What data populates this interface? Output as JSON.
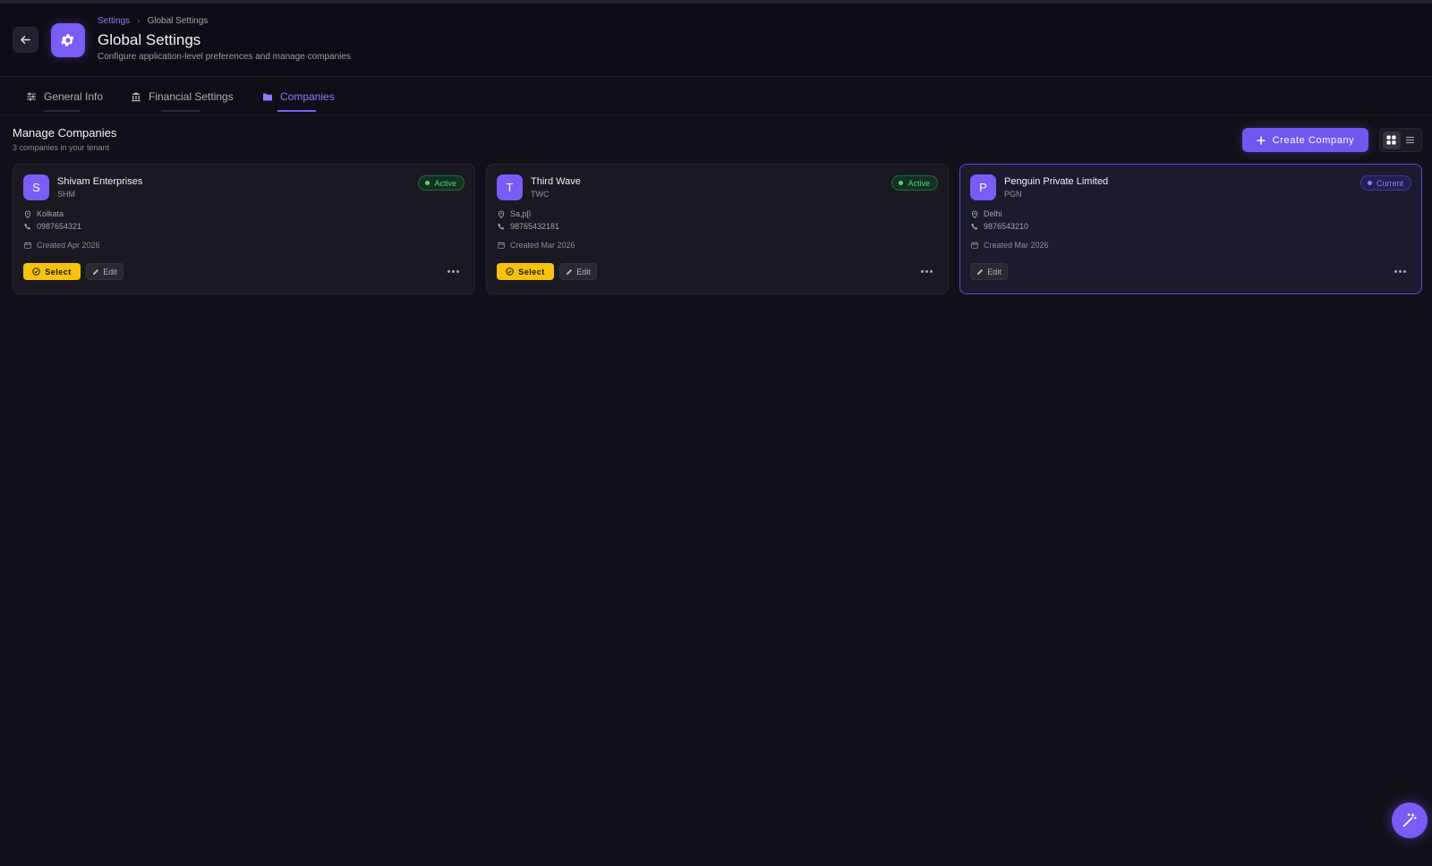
{
  "header": {
    "breadcrumb": {
      "parent": "Settings",
      "current": "Global Settings"
    },
    "title": "Global Settings",
    "subtitle": "Configure application-level preferences and manage companies",
    "icon": "gear-icon"
  },
  "tabs": [
    {
      "label": "General Info",
      "icon": "sliders-icon",
      "active": false
    },
    {
      "label": "Financial Settings",
      "icon": "bank-icon",
      "active": false
    },
    {
      "label": "Companies",
      "icon": "folder-icon",
      "active": true
    }
  ],
  "section": {
    "title": "Manage Companies",
    "subtitle": "3 companies in your tenant",
    "create_label": "Create Company",
    "view_mode": "grid"
  },
  "companies": [
    {
      "initial": "S",
      "name": "Shivam Enterprises",
      "code": "SHM",
      "status": "Active",
      "location": "Kolkata",
      "phone": "0987654321",
      "created": "Created Apr 2026",
      "select_label": "Select",
      "edit_label": "Edit"
    },
    {
      "initial": "T",
      "name": "Third Wave",
      "code": "TWC",
      "status": "Active",
      "location": "Sa,p[l",
      "phone": "98765432181",
      "created": "Created Mar 2026",
      "select_label": "Select",
      "edit_label": "Edit"
    },
    {
      "initial": "P",
      "name": "Penguin Private Limited",
      "code": "PGN",
      "status": "Current",
      "location": "Delhi",
      "phone": "9876543210",
      "created": "Created Mar 2026",
      "edit_label": "Edit"
    }
  ],
  "colors": {
    "accent": "#7a5cf6",
    "select": "#f6c20c",
    "active_status": "#4fd587",
    "current_status": "#8a7ef8"
  }
}
